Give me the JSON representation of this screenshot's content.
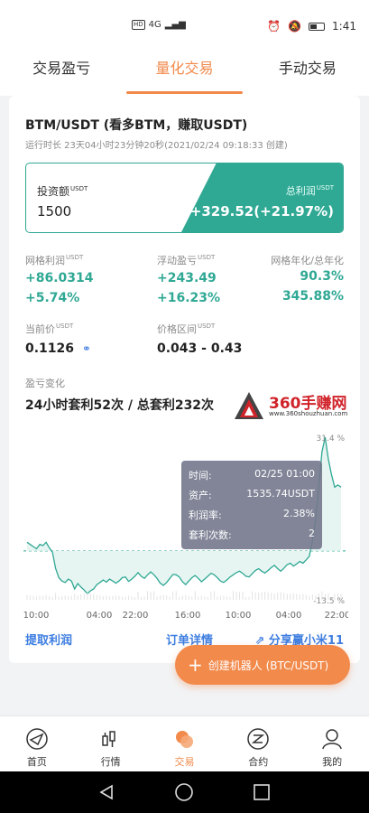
{
  "status": {
    "time": "1:41",
    "hd": "HD",
    "net": "4G"
  },
  "tabs": [
    {
      "label": "交易盈亏"
    },
    {
      "label": "量化交易"
    },
    {
      "label": "手动交易"
    }
  ],
  "strategy": {
    "title": "BTM/USDT (看多BTM，赚取USDT)",
    "runtime": "运行时长 23天04小时23分钟20秒(2021/02/24 09:18:33 创建)"
  },
  "summary": {
    "invest_label": "投资额",
    "invest_unit": "USDT",
    "invest_value": "1500",
    "profit_label": "总利润",
    "profit_unit": "USDT",
    "profit_value": "+329.52(+21.97%)"
  },
  "metrics": {
    "grid_profit": {
      "label": "网格利润",
      "unit": "USDT",
      "value": "+86.0314",
      "pct": "+5.74%"
    },
    "float_profit": {
      "label": "浮动盈亏",
      "unit": "USDT",
      "value": "+243.49",
      "pct": "+16.23%"
    },
    "annual": {
      "label": "网格年化/总年化",
      "value1": "90.3%",
      "value2": "345.88%"
    },
    "price": {
      "label": "当前价",
      "unit": "USDT",
      "value": "0.1126"
    },
    "range": {
      "label": "价格区间",
      "unit": "USDT",
      "value": "0.043 - 0.43"
    }
  },
  "pnl": {
    "label": "盈亏变化",
    "arbitrage": "24小时套利52次 / 总套利232次"
  },
  "watermark": {
    "main": "360手赚网",
    "url": "www.360shouzhuan.com"
  },
  "chart_data": {
    "type": "line",
    "x_ticks": [
      "10:00",
      "04:00",
      "22:00",
      "16:00",
      "10:00",
      "04:00",
      "22:00"
    ],
    "y_ticks": [
      "31.4 %",
      "-13.5 %"
    ],
    "ylim": [
      -13.5,
      31.4
    ],
    "colors": {
      "line": "#2fa894",
      "area": "#e6f5f1",
      "baseline": "#2fa894"
    },
    "values": [
      2.4,
      1.8,
      1.2,
      0.6,
      1.8,
      1.5,
      2.4,
      0.9,
      -0.3,
      -4.8,
      -7.4,
      -8.3,
      -8.7,
      -7.8,
      -8.3,
      -10.5,
      -9.0,
      -10.0,
      -10.8,
      -11.8,
      -11.0,
      -10.5,
      -9.3,
      -8.7,
      -8.0,
      -8.6,
      -7.8,
      -8.3,
      -8.9,
      -8.3,
      -7.4,
      -7.2,
      -8.4,
      -7.8,
      -7.0,
      -6.0,
      -7.0,
      -7.6,
      -6.6,
      -5.8,
      -6.6,
      -7.6,
      -8.9,
      -9.5,
      -8.7,
      -7.6,
      -6.5,
      -6.6,
      -7.2,
      -8.5,
      -9.3,
      -8.3,
      -7.4,
      -6.8,
      -7.6,
      -8.5,
      -7.8,
      -7.0,
      -6.2,
      -6.6,
      -7.4,
      -8.3,
      -8.7,
      -8.0,
      -7.2,
      -6.6,
      -6.0,
      -5.6,
      -6.2,
      -7.0,
      -7.2,
      -6.3,
      -5.4,
      -4.9,
      -5.6,
      -6.1,
      -5.4,
      -4.6,
      -4.0,
      -4.9,
      -5.6,
      -4.8,
      -3.8,
      -3.4,
      -4.2,
      -3.6,
      -2.9,
      -3.4,
      -2.5,
      -1.5,
      3.0,
      8.8,
      18.0,
      27.4,
      31.4,
      25.4,
      21.0,
      17.6,
      18.2,
      17.6
    ]
  },
  "tooltip": {
    "time_label": "时间:",
    "time_value": "02/25 01:00",
    "asset_label": "资产:",
    "asset_value": "1535.74USDT",
    "rate_label": "利润率:",
    "rate_value": "2.38%",
    "count_label": "套利次数:",
    "count_value": "2"
  },
  "actions": {
    "withdraw": "提取利润",
    "orders": "订单详情",
    "share": "分享赢小米11"
  },
  "fab": {
    "label": "创建机器人 (BTC/USDT)"
  },
  "nav": [
    {
      "label": "首页"
    },
    {
      "label": "行情"
    },
    {
      "label": "交易"
    },
    {
      "label": "合约"
    },
    {
      "label": "我的"
    }
  ]
}
